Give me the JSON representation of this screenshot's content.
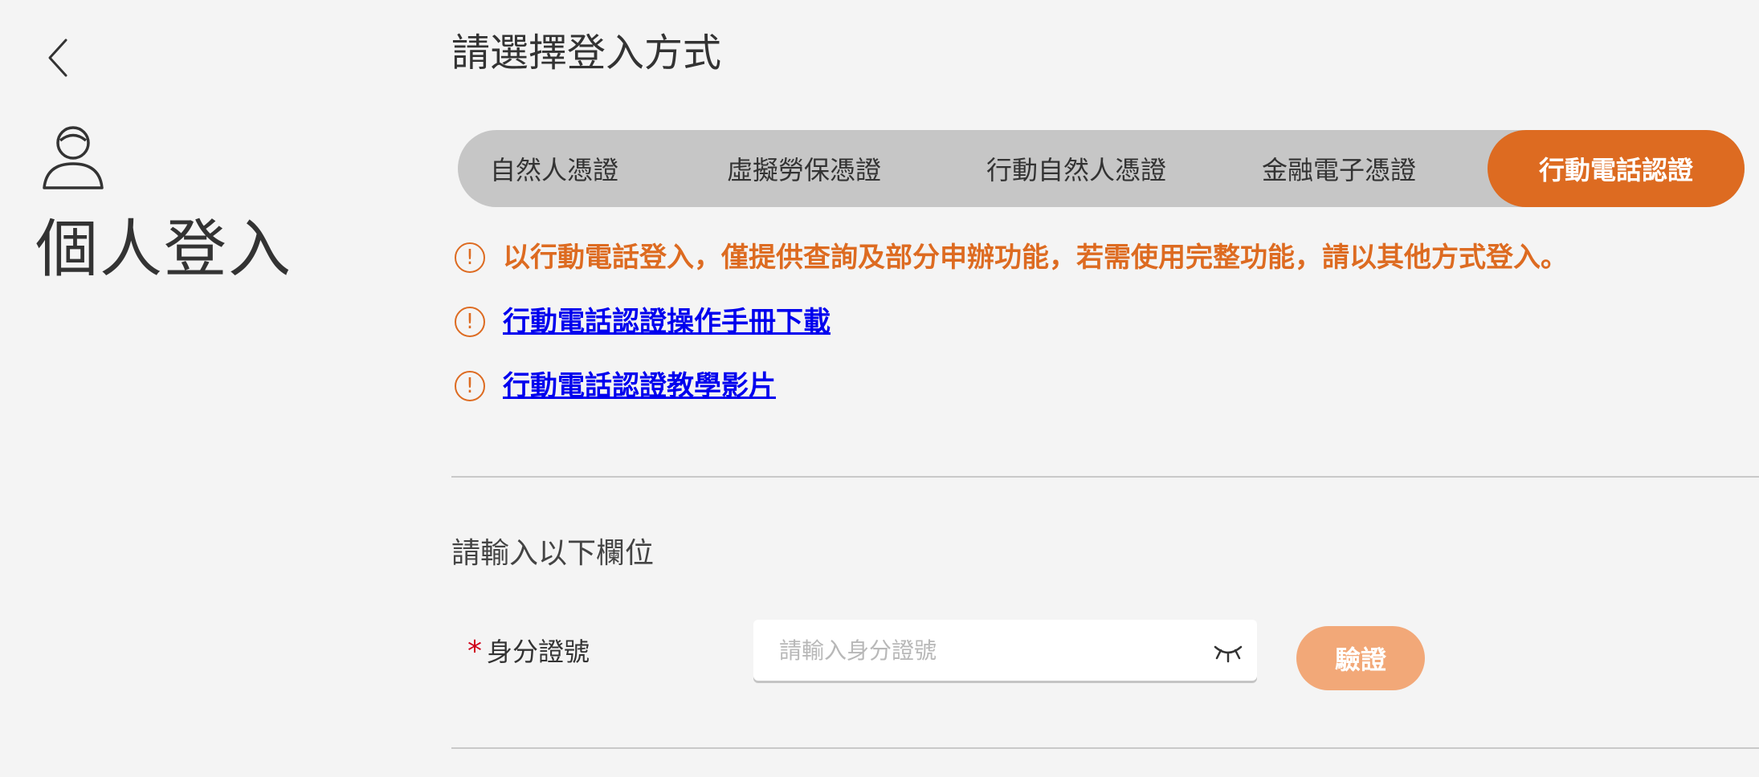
{
  "sidebar": {
    "back_icon": "chevron-left-icon",
    "user_icon": "user-icon",
    "heading": "個人登入"
  },
  "main": {
    "title": "請選擇登入方式",
    "tabs": [
      {
        "label": "自然人憑證",
        "active": false
      },
      {
        "label": "虛擬勞保憑證",
        "active": false
      },
      {
        "label": "行動自然人憑證",
        "active": false
      },
      {
        "label": "金融電子憑證",
        "active": false
      },
      {
        "label": "行動電話認證",
        "active": true
      }
    ],
    "notices": [
      {
        "icon": "alert-circle-icon",
        "text": "以行動電話登入，僅提供查詢及部分申辦功能，若需使用完整功能，請以其他方式登入。"
      },
      {
        "icon": "alert-circle-icon",
        "text": "行動電話認證操作手冊下載"
      },
      {
        "icon": "alert-circle-icon",
        "text": "行動電話認證教學影片"
      }
    ],
    "alert_glyph": "!",
    "form": {
      "subtitle": "請輸入以下欄位",
      "required_mark": "*",
      "id_label": "身分證號",
      "id_value": "",
      "id_placeholder": "請輸入身分證號",
      "visibility_icon": "eye-closed-icon",
      "verify_label": "驗證"
    }
  },
  "colors": {
    "accent": "#dd6b21",
    "accent_disabled": "#f2a878",
    "link": "#0000ee",
    "required": "#d0021b",
    "tab_bar": "#c6c6c6",
    "background": "#f4f4f4"
  }
}
